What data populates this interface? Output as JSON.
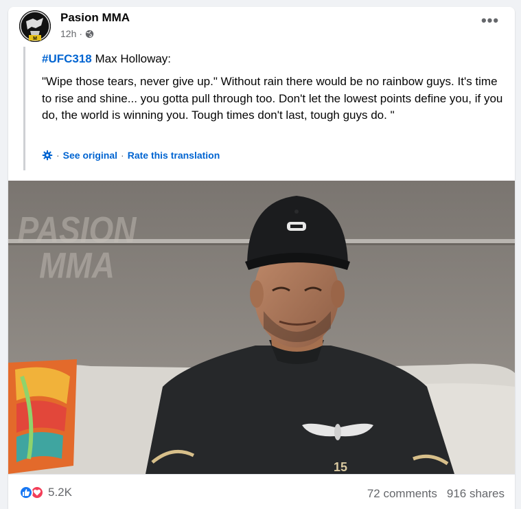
{
  "post": {
    "page_name": "Pasion MMA",
    "time": "12h",
    "dot": "·",
    "avatar_icon": "pasion-mma-logo",
    "privacy_icon": "globe-icon",
    "more_label": "•••"
  },
  "translation": {
    "hashtag": "#UFC318",
    "subject": " Max Holloway:",
    "quote": "\"Wipe those tears, never give up.\" Without rain there would be no rainbow guys. It's time to rise and shine... you gotta pull through too. Don't let the lowest points define you, if you do, the world is winning you. Tough times don't last, tough guys do. \"",
    "see_original": "See original",
    "rate_translation": "Rate this translation",
    "sep": "·"
  },
  "media": {
    "watermark_line1": "PASION",
    "watermark_line2": "MMA",
    "shirt_number": "15"
  },
  "footer": {
    "reaction_count": "5.2K",
    "comments": "72 comments",
    "shares": "916 shares",
    "reaction_icons": [
      "like-icon",
      "love-icon"
    ]
  },
  "colors": {
    "link": "#0064d1",
    "like": "#1877f2",
    "love": "#f33e58",
    "secondary_text": "#65676b"
  }
}
